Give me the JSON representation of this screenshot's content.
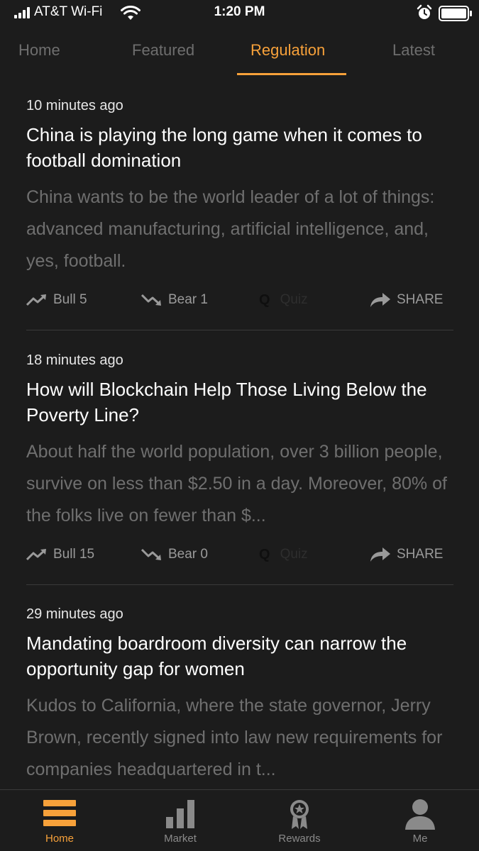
{
  "status_bar": {
    "carrier": "AT&T Wi-Fi",
    "time": "1:20 PM",
    "signal_bars": 4
  },
  "tabs": [
    {
      "label": "Home",
      "active": false
    },
    {
      "label": "Featured",
      "active": false
    },
    {
      "label": "Regulation",
      "active": true
    },
    {
      "label": "Latest",
      "active": false
    }
  ],
  "articles": [
    {
      "time": "10 minutes ago",
      "title": "China is playing the long game when it comes to football domination",
      "summary": "China wants to be the world leader of a lot of things: advanced manufacturing, artificial intelligence, and, yes, football.",
      "bull_label": "Bull 5",
      "bear_label": "Bear 1",
      "quiz_icon": "Q",
      "quiz_label": "Quiz",
      "share_label": "SHARE"
    },
    {
      "time": "18 minutes ago",
      "title": "How will Blockchain Help Those Living Below the Poverty Line?",
      "summary": "About half the world population, over 3 billion people, survive on less than $2.50 in a day. Moreover, 80% of the folks live on fewer than $...",
      "bull_label": "Bull 15",
      "bear_label": "Bear 0",
      "quiz_icon": "Q",
      "quiz_label": "Quiz",
      "share_label": "SHARE"
    },
    {
      "time": "29 minutes ago",
      "title": "Mandating boardroom diversity can narrow the opportunity gap for women",
      "summary": "Kudos to California, where the state governor, Jerry Brown, recently signed into law new requirements for companies headquartered in t...",
      "bull_label": "",
      "bear_label": "",
      "quiz_icon": "",
      "quiz_label": "",
      "share_label": ""
    }
  ],
  "bottom_nav": [
    {
      "label": "Home",
      "icon": "home-icon",
      "active": true
    },
    {
      "label": "Market",
      "icon": "market-icon",
      "active": false
    },
    {
      "label": "Rewards",
      "icon": "rewards-icon",
      "active": false
    },
    {
      "label": "Me",
      "icon": "profile-icon",
      "active": false
    }
  ],
  "colors": {
    "accent": "#f7a13a",
    "background": "#1c1c1c",
    "muted_text": "#6f6f6f"
  }
}
